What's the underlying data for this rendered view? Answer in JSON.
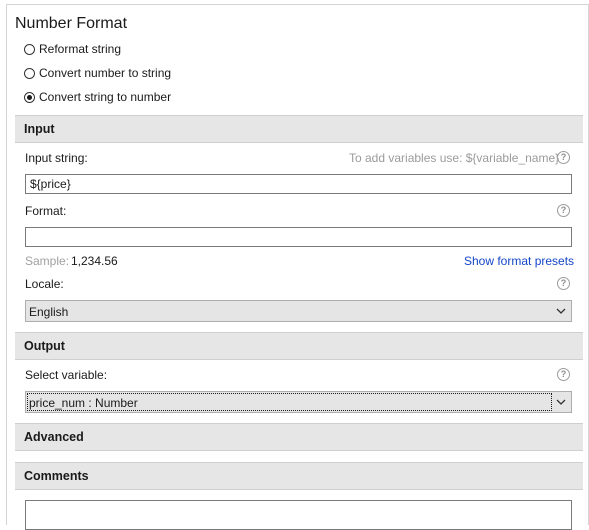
{
  "title": "Number Format",
  "modes": [
    {
      "label": "Reformat string",
      "checked": false
    },
    {
      "label": "Convert number to string",
      "checked": false
    },
    {
      "label": "Convert string to number",
      "checked": true
    }
  ],
  "input_section": {
    "header": "Input",
    "input_string_label": "Input string:",
    "variables_hint": "To add variables use: ${variable_name}",
    "input_string_value": "${price}",
    "format_label": "Format:",
    "format_value": "",
    "sample_label": "Sample:",
    "sample_value": "1,234.56",
    "show_presets_link": "Show format presets",
    "locale_label": "Locale:",
    "locale_value": "English"
  },
  "output_section": {
    "header": "Output",
    "select_variable_label": "Select variable:",
    "variable_value": "price_num : Number"
  },
  "advanced_section": {
    "header": "Advanced"
  },
  "comments_section": {
    "header": "Comments",
    "value": ""
  },
  "help_glyph": "?",
  "icons": [
    "radio-icon",
    "help-icon",
    "chevron-down-icon"
  ]
}
